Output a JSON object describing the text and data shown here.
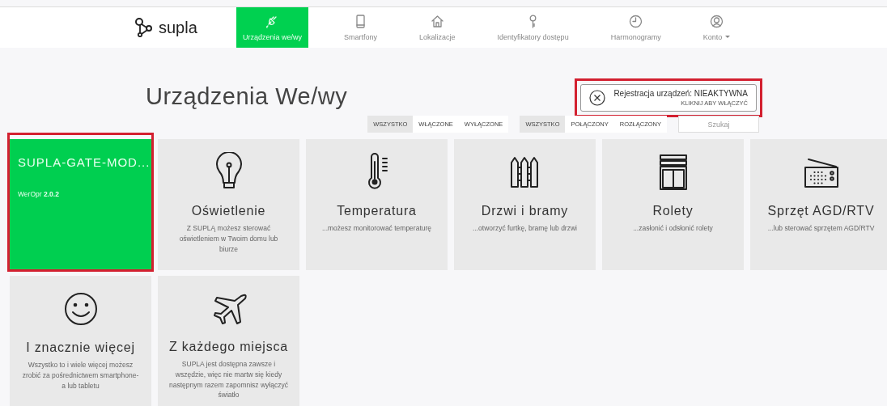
{
  "nav": {
    "logo": "supla",
    "tabs": [
      {
        "label": "Urządzenia we/wy",
        "selected": true,
        "dropdown": false
      },
      {
        "label": "Smartfony",
        "selected": false,
        "dropdown": false
      },
      {
        "label": "Lokalizacje",
        "selected": false,
        "dropdown": false
      },
      {
        "label": "Identyfikatory dostępu",
        "selected": false,
        "dropdown": false
      },
      {
        "label": "Harmonogramy",
        "selected": false,
        "dropdown": false
      },
      {
        "label": "Konto",
        "selected": false,
        "dropdown": true
      }
    ]
  },
  "page_title": "Urządzenia We/wy",
  "registration": {
    "title": "Rejestracja urządzeń: NIEAKTYWNA",
    "action": "KLIKNIJ ABY WŁĄCZYĆ",
    "highlighted": true
  },
  "filters": [
    {
      "options": [
        {
          "label": "WSZYSTKO",
          "selected": true
        },
        {
          "label": "WŁĄCZONE",
          "selected": false
        },
        {
          "label": "WYŁĄCZONE",
          "selected": false
        }
      ]
    },
    {
      "options": [
        {
          "label": "WSZYSTKO",
          "selected": true
        },
        {
          "label": "POŁĄCZONY",
          "selected": false
        },
        {
          "label": "ROZŁĄCZONY",
          "selected": false
        }
      ]
    }
  ],
  "search": {
    "placeholder": "Szukaj"
  },
  "cards": [
    {
      "kind": "device",
      "name": "SUPLA-GATE-MOD...",
      "version": "WerOpr **2.0.2**",
      "highlighted": true
    },
    {
      "kind": "feature",
      "title": "Oświetlenie",
      "description": "Z SUPLĄ możesz sterować oświetleniem w Twoim domu lub biurze"
    },
    {
      "kind": "feature",
      "title": "Temperatura",
      "description": "...możesz monitorować temperaturę"
    },
    {
      "kind": "feature",
      "title": "Drzwi i bramy",
      "description": "...otworzyć furtkę, bramę lub drzwi"
    },
    {
      "kind": "feature",
      "title": "Rolety",
      "description": "...zasłonić i odsłonić rolety"
    },
    {
      "kind": "feature",
      "title": "Sprzęt AGD/RTV",
      "description": "...lub sterować sprzętem AGD/RTV"
    },
    {
      "kind": "feature",
      "title": "I znacznie więcej",
      "description": "Wszystko to i wiele więcej możesz zrobić za pośrednictwem smartphone-a lub tabletu"
    },
    {
      "kind": "feature",
      "title": "Z każdego miejsca",
      "description": "SUPLA jest dostępna zawsze i wszędzie, więc nie martw się kiedy następnym razem zapomnisz wyłączyć światło"
    }
  ]
}
